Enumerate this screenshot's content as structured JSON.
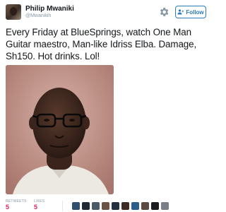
{
  "author": {
    "name": "Philip Mwaniki",
    "handle": "@Mwanikih"
  },
  "actions": {
    "follow_label": "Follow",
    "settings_icon": "gear-icon",
    "follow_icon": "add-user-icon"
  },
  "tweet": {
    "text": "Every Friday at BlueSprings, watch One Man Guitar maestro, Man-like Idriss Elba. Damage, Sh150. Hot drinks. Lol!"
  },
  "stats": {
    "retweets_label": "RETWEETS",
    "retweets_count": "5",
    "likes_label": "LIKES",
    "likes_count": "5"
  },
  "liker_avatars": [
    {
      "color": "#2f4f6f"
    },
    {
      "color": "#1f2a35"
    },
    {
      "color": "#4b5a66"
    },
    {
      "color": "#6b5343"
    },
    {
      "color": "#22313d"
    },
    {
      "color": "#3a2b25"
    },
    {
      "color": "#2c5d8a"
    },
    {
      "color": "#5a4a40"
    },
    {
      "color": "#1d1d1f"
    },
    {
      "color": "#7a7f85"
    }
  ],
  "colors": {
    "accent": "#2b7bb9",
    "count": "#e0245e",
    "muted": "#8899a6",
    "text": "#14171a"
  }
}
